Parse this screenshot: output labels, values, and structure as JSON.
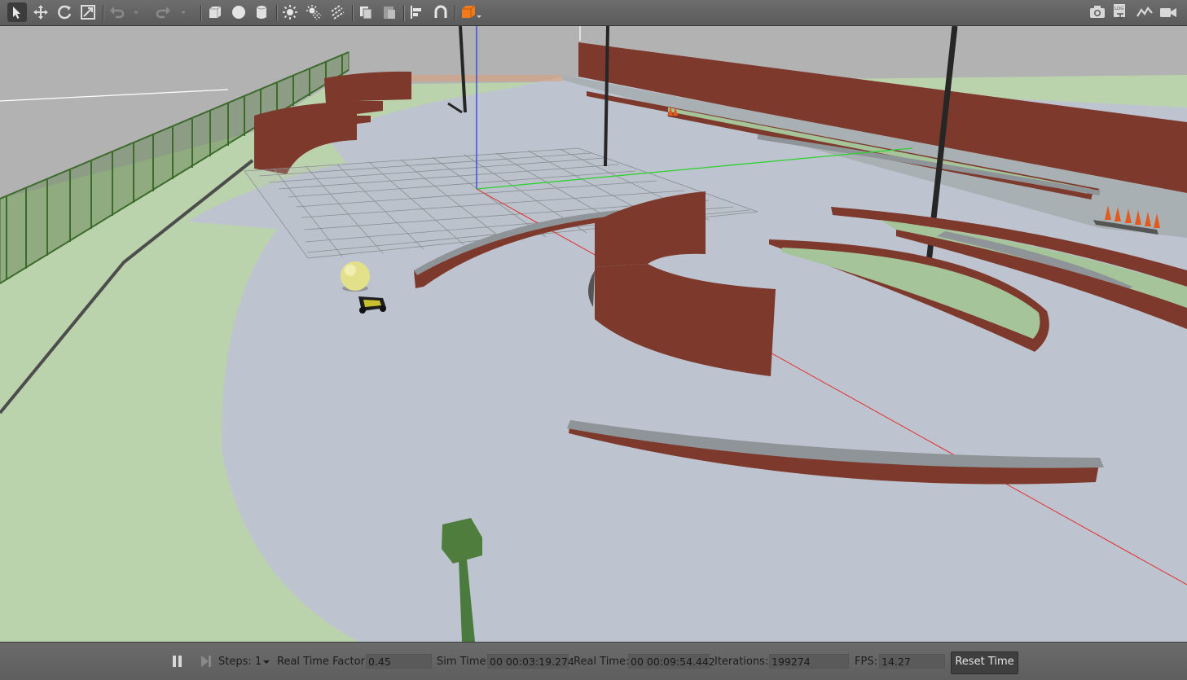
{
  "toolbar": {
    "left_tools": [
      {
        "icon": "select-arrow-icon",
        "active": true
      },
      {
        "icon": "translate-icon"
      },
      {
        "icon": "rotate-icon"
      },
      {
        "icon": "scale-icon"
      },
      {
        "icon": "undo-icon"
      },
      {
        "icon": "undo-dropdown-icon"
      },
      {
        "icon": "redo-icon"
      },
      {
        "icon": "redo-dropdown-icon"
      },
      {
        "icon": "box-shape-icon"
      },
      {
        "icon": "sphere-shape-icon"
      },
      {
        "icon": "cylinder-shape-icon"
      },
      {
        "icon": "point-light-icon"
      },
      {
        "icon": "spot-light-icon"
      },
      {
        "icon": "directional-light-icon"
      },
      {
        "icon": "copy-icon"
      },
      {
        "icon": "paste-icon"
      },
      {
        "icon": "align-icon"
      },
      {
        "icon": "snap-icon"
      },
      {
        "icon": "view-angle-icon"
      }
    ],
    "right_tools": [
      {
        "icon": "screenshot-camera-icon"
      },
      {
        "icon": "log-icon",
        "label": "LOG"
      },
      {
        "icon": "plot-icon"
      },
      {
        "icon": "video-record-icon"
      }
    ]
  },
  "bottom_bar": {
    "steps_label": "Steps:",
    "steps_value": "1",
    "real_time_factor_label": "Real Time Factor:",
    "real_time_factor_value": "0.45",
    "sim_time_label": "Sim Time:",
    "sim_time_value": "00 00:03:19.274",
    "real_time_label": "Real Time:",
    "real_time_value": "00 00:09:54.442",
    "iterations_label": "Iterations:",
    "iterations_value": "199274",
    "fps_label": "FPS:",
    "fps_value": "14.27",
    "reset_time_label": "Reset Time"
  },
  "colors": {
    "sky": "#b2b2b2",
    "ground": "#bbd3ac",
    "floor": "#bec4cf",
    "wall_red": "#7d3a2c",
    "curb_gray": "#8e9498",
    "fence_green": "#3d6b2c",
    "orange_accent": "#f07a1c"
  }
}
